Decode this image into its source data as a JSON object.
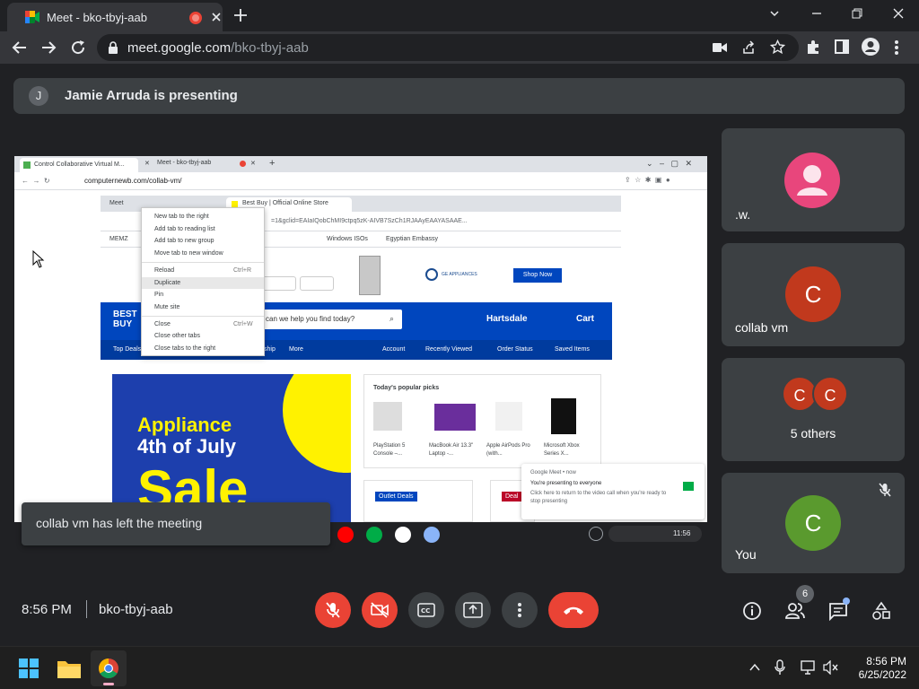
{
  "browser": {
    "tab_title": "Meet - bko-tbyj-aab",
    "url_host": "meet.google.com",
    "url_path": "/bko-tbyj-aab"
  },
  "meet": {
    "presenter_initial": "J",
    "presenter_text": "Jamie Arruda is presenting",
    "tiles": [
      {
        "name": ".w.",
        "initial": "",
        "avatar_color": "#e8467c"
      },
      {
        "name": "collab vm",
        "initial": "C",
        "avatar_color": "#c1391d"
      },
      {
        "name": "5 others",
        "initial": "C",
        "avatar_color": "#c1391d"
      },
      {
        "name": "You",
        "initial": "C",
        "avatar_color": "#5a9a2e"
      }
    ],
    "toast": "collab vm has left the meeting",
    "time": "8:56 PM",
    "meeting_code": "bko-tbyj-aab",
    "people_count": "6"
  },
  "shared": {
    "tab1": "Control Collaborative Virtual M...",
    "tab2": "Meet - bko-tbyj-aab",
    "url": "computernewb.com/collab-vm/",
    "inner_tab1": "Meet",
    "inner_tab2": "Best Buy | Official Online Store",
    "inner_url": "=1&gclid=EAIaIQobChMI9ctpq5zK-AIVB7SzCh1RJAAyEAAYASAAE...",
    "bookmarks": [
      "MEMZ",
      "Windows ISOs",
      "Egyptian Embassy"
    ],
    "context_menu": [
      "New tab to the right",
      "Add tab to reading list",
      "Add tab to new group",
      "Move tab to new window",
      "Reload",
      "Duplicate",
      "Pin",
      "Mute site",
      "Close",
      "Close other tabs",
      "Close tabs to the right"
    ],
    "reload_shortcut": "Ctrl+R",
    "close_shortcut": "Ctrl+W",
    "ad_brand": "GE APPLIANCES",
    "shop_now": "Shop Now",
    "search_placeholder": "can we help you find today?",
    "store": "Hartsdale",
    "cart": "Cart",
    "nav": [
      "Top Deals",
      "ship",
      "More",
      "Account",
      "Recently Viewed",
      "Order Status",
      "Saved Items"
    ],
    "promo_line1": "Appliance",
    "promo_line2": "4th of July",
    "promo_line3": "Sale",
    "popular_title": "Today's popular picks",
    "products": [
      "PlayStation 5 Console –...",
      "MacBook Air 13.3\" Laptop -...",
      "Apple  AirPods Pro (with...",
      "Microsoft Xbox Series X..."
    ],
    "outlet": "Outlet Deals",
    "deal": "Deal",
    "notif_source": "Google Meet • now",
    "notif_title": "You're presenting to everyone",
    "notif_body": "Click here to return to the video call when you're ready to stop presenting",
    "taskbar_time": "11:56"
  },
  "taskbar": {
    "time": "8:56 PM",
    "date": "6/25/2022"
  }
}
